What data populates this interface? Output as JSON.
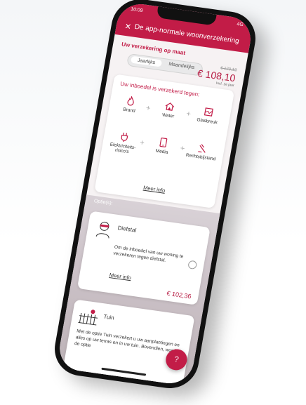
{
  "status_bar": {
    "time": "10:09",
    "signal": "4G"
  },
  "header": {
    "close_icon": "close-icon",
    "title": "De app-normale woonverzekering"
  },
  "custom": {
    "label": "Uw verzekering op maat"
  },
  "period_toggle": {
    "options": [
      "Jaarlijks",
      "Maandelijks"
    ],
    "selected": "Jaarlijks"
  },
  "price": {
    "old": "€ 129,12",
    "current": "€ 108,10",
    "per": "Incl. 1e jaar"
  },
  "coverage": {
    "heading": "Uw inboedel is verzekerd tegen:",
    "items": [
      {
        "label": "Brand",
        "icon": "flame-icon"
      },
      {
        "label": "Water",
        "icon": "house-water-icon"
      },
      {
        "label": "Glasbreuk",
        "icon": "broken-glass-icon"
      },
      {
        "label": "Elektriciteits-risico's",
        "icon": "plug-icon"
      },
      {
        "label": "Media",
        "icon": "media-icon"
      },
      {
        "label": "Rechtsbijstand",
        "icon": "gavel-icon"
      }
    ],
    "more": "Meer info"
  },
  "options": {
    "label": "Optie(s):",
    "diefstal": {
      "title": "Diefstal",
      "desc": "Om de inboedel van uw woning te verzekeren tegen diefstal.",
      "more": "Meer info",
      "price": "€ 102,36"
    },
    "tuin": {
      "title": "Tuin",
      "desc": "Met de optie Tuin verzekert u uw aanplantingen en alles op uw terras en in uw tuin. Bovendien, wordt de optie"
    }
  },
  "help": {
    "label": "?"
  },
  "colors": {
    "brand": "#c21c47"
  }
}
